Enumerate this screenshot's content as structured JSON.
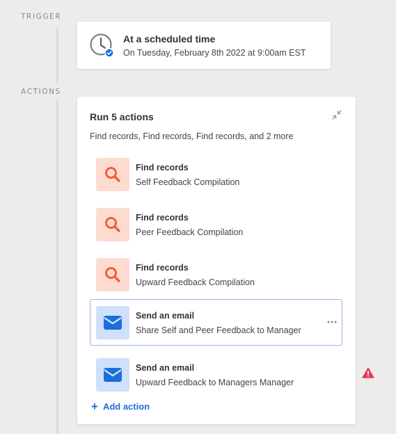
{
  "trigger": {
    "section_label": "TRIGGER",
    "title": "At a scheduled time",
    "subtitle": "On Tuesday, February 8th 2022 at 9:00am EST",
    "icon": "clock-icon"
  },
  "actions": {
    "section_label": "ACTIONS",
    "title": "Run 5 actions",
    "subtitle": "Find records, Find records, Find records, and 2 more",
    "collapse_icon": "collapse-icon",
    "items": [
      {
        "name": "Find records",
        "description": "Self Feedback Compilation",
        "icon": "search-icon"
      },
      {
        "name": "Find records",
        "description": "Peer Feedback Compilation",
        "icon": "search-icon"
      },
      {
        "name": "Find records",
        "description": "Upward Feedback Compilation",
        "icon": "search-icon"
      },
      {
        "name": "Send an email",
        "description": "Share Self and Peer Feedback to Manager",
        "icon": "envelope-icon",
        "selected": true
      },
      {
        "name": "Send an email",
        "description": "Upward Feedback to Managers Manager",
        "icon": "envelope-icon",
        "warning": true
      }
    ],
    "add_action_label": "Add action",
    "add_action_icon": "+"
  },
  "colors": {
    "accent": "#1a6fd8",
    "find_icon": "#f25d35",
    "find_icon_bg": "#fddbd1",
    "email_icon": "#1a6fd8",
    "email_icon_bg": "#cfe0fb",
    "warning": "#e8345a",
    "selected_border": "#8fb4ea"
  }
}
